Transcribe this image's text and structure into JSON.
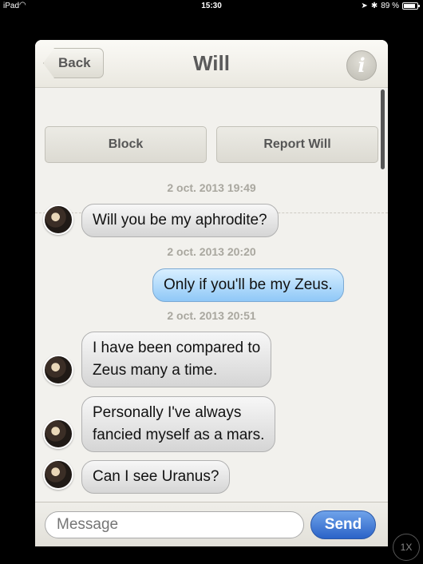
{
  "status_bar": {
    "carrier": "iPad",
    "wifi_icon": "wifi-icon",
    "time": "15:30",
    "battery_text": "89 %",
    "battery_level": 0.89
  },
  "nav": {
    "back_label": "Back",
    "title": "Will",
    "info_glyph": "i"
  },
  "actions": {
    "block_label": "Block",
    "report_label": "Report Will"
  },
  "timestamps": [
    "2 oct. 2013 19:49",
    "2 oct. 2013 20:20",
    "2 oct. 2013 20:51"
  ],
  "messages": [
    {
      "direction": "incoming",
      "lines": [
        "Will you be my aphrodite?"
      ]
    },
    {
      "direction": "outgoing",
      "lines": [
        "Only if you'll be my Zeus."
      ]
    },
    {
      "direction": "incoming",
      "lines": [
        "I have been compared to",
        "Zeus many a time."
      ]
    },
    {
      "direction": "incoming",
      "lines": [
        "Personally I've always",
        "fancied myself as a mars."
      ]
    },
    {
      "direction": "incoming",
      "lines": [
        "Can I see Uranus?"
      ]
    }
  ],
  "composer": {
    "placeholder": "Message",
    "send_label": "Send"
  },
  "zoom_label": "1X",
  "colors": {
    "incoming_bubble": "#e4e4e4",
    "outgoing_bubble": "#a9d4f8",
    "send_button": "#3a74d8",
    "timestamp": "#a9a79f"
  }
}
